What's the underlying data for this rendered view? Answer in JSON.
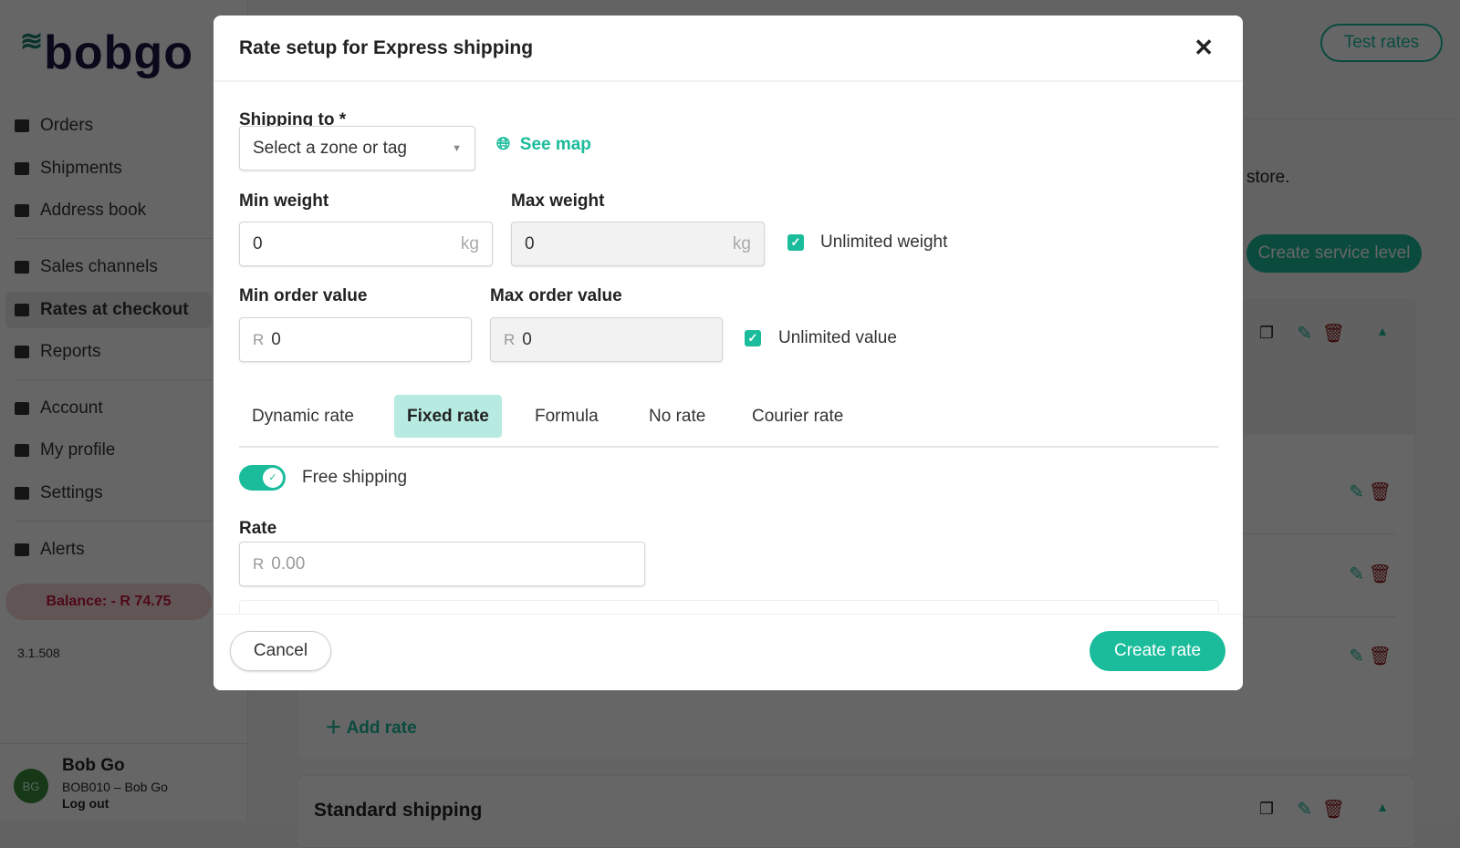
{
  "sidebar": {
    "logo": "bobgo",
    "items": [
      {
        "label": "Orders",
        "icon": "box-icon"
      },
      {
        "label": "Shipments",
        "icon": "truck-icon"
      },
      {
        "label": "Address book",
        "icon": "address-book-icon"
      },
      {
        "label": "Sales channels",
        "icon": "sitemap-icon"
      },
      {
        "label": "Rates at checkout",
        "icon": "store-icon"
      },
      {
        "label": "Reports",
        "icon": "report-icon"
      },
      {
        "label": "Account",
        "icon": "star-icon"
      },
      {
        "label": "My profile",
        "icon": "user-icon"
      },
      {
        "label": "Settings",
        "icon": "gear-icon"
      },
      {
        "label": "Alerts",
        "icon": "bell-icon"
      }
    ],
    "balance": "Balance: - R 74.75",
    "version": "3.1.508",
    "user": {
      "initials": "BG",
      "name": "Bob Go",
      "account": "BOB010 – Bob Go",
      "logout": "Log out"
    }
  },
  "background": {
    "test_rates": "Test rates",
    "desc_fragment": "store.",
    "create_service_level": "Create service level",
    "add_rate": "Add rate",
    "standard_shipping": "Standard shipping"
  },
  "modal": {
    "title": "Rate setup for Express shipping",
    "shipping_to_label": "Shipping to *",
    "zone_placeholder": "Select a zone or tag",
    "see_map": "See map",
    "min_weight_label": "Min weight",
    "min_weight": "0",
    "max_weight_label": "Max weight",
    "max_weight": "0",
    "weight_unit": "kg",
    "unlimited_weight": "Unlimited weight",
    "unlimited_weight_checked": true,
    "min_order_label": "Min order value",
    "min_order": "0",
    "max_order_label": "Max order value",
    "max_order": "0",
    "currency": "R",
    "unlimited_value": "Unlimited value",
    "unlimited_value_checked": true,
    "tabs": [
      "Dynamic rate",
      "Fixed rate",
      "Formula",
      "No rate",
      "Courier rate"
    ],
    "active_tab": "Fixed rate",
    "free_shipping": "Free shipping",
    "free_shipping_on": true,
    "rate_label": "Rate",
    "rate_placeholder": "0.00",
    "cancel": "Cancel",
    "create": "Create rate"
  },
  "colors": {
    "accent": "#1abc9c",
    "danger": "#c2143c",
    "brand": "#1e1446"
  }
}
